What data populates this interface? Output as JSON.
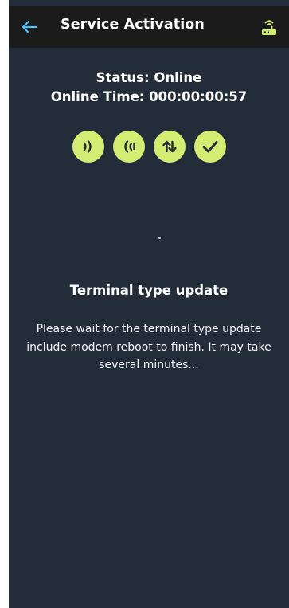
{
  "header": {
    "back_icon": "arrow-left-icon",
    "title": "Service Activation",
    "modem_icon": "modem-router-icon"
  },
  "status": {
    "state": "Status: Online",
    "online_time": "Online Time: 000:00:00:57"
  },
  "indicators": [
    {
      "icon": "signal-right-icon"
    },
    {
      "icon": "signal-left-icon"
    },
    {
      "icon": "up-down-arrows-icon"
    },
    {
      "icon": "check-icon"
    }
  ],
  "update": {
    "title": "Terminal type update",
    "message": "Please wait for the terminal type update include modem reboot to finish. It may take several minutes..."
  },
  "colors": {
    "background": "#232d3a",
    "app_bar": "#1b1b1b",
    "accent": "#d3ed73",
    "back_arrow": "#4fc3f7"
  }
}
